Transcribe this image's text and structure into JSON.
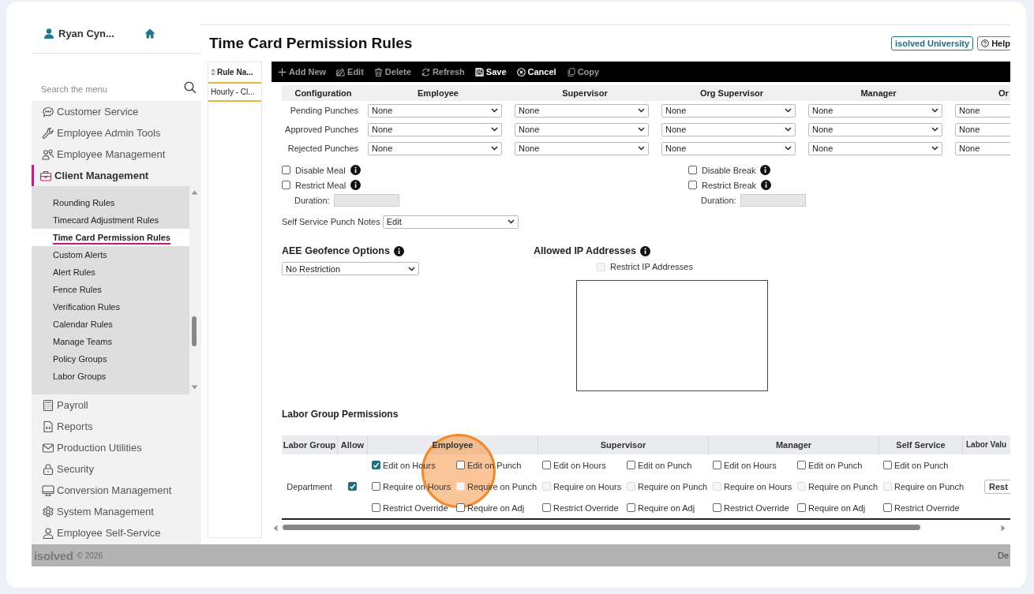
{
  "user": {
    "name": "Ryan Cyn..."
  },
  "search": {
    "placeholder": "Search the menu"
  },
  "nav": [
    {
      "label": "Customer Service",
      "selected": false
    },
    {
      "label": "Employee Admin Tools",
      "selected": false
    },
    {
      "label": "Employee Management",
      "selected": false
    },
    {
      "label": "Client Management",
      "selected": true,
      "children": [
        {
          "label": "Rounding Rules",
          "selected": false
        },
        {
          "label": "Timecard Adjustment Rules",
          "selected": false
        },
        {
          "label": "Time Card Permission Rules",
          "selected": true
        },
        {
          "label": "Custom Alerts",
          "selected": false
        },
        {
          "label": "Alert Rules",
          "selected": false
        },
        {
          "label": "Fence Rules",
          "selected": false
        },
        {
          "label": "Verification Rules",
          "selected": false
        },
        {
          "label": "Calendar Rules",
          "selected": false
        },
        {
          "label": "Manage Teams",
          "selected": false
        },
        {
          "label": "Policy Groups",
          "selected": false
        },
        {
          "label": "Labor Groups",
          "selected": false
        }
      ]
    },
    {
      "label": "Payroll",
      "selected": false
    },
    {
      "label": "Reports",
      "selected": false
    },
    {
      "label": "Production Utilities",
      "selected": false
    },
    {
      "label": "Security",
      "selected": false
    },
    {
      "label": "Conversion Management",
      "selected": false
    },
    {
      "label": "System Management",
      "selected": false
    },
    {
      "label": "Employee Self-Service",
      "selected": false
    }
  ],
  "page_title": "Time Card Permission Rules",
  "header_links": [
    {
      "label": "isolved University"
    },
    {
      "label": "Help"
    }
  ],
  "rules_list": {
    "column": "Rule Na...",
    "rows": [
      {
        "label": "Hourly - Cl...",
        "selected": true
      }
    ]
  },
  "toolbar": [
    {
      "label": "Add New",
      "disabled": true
    },
    {
      "label": "Edit",
      "disabled": true
    },
    {
      "label": "Delete",
      "disabled": true
    },
    {
      "label": "Refresh",
      "disabled": true
    },
    {
      "label": "Save",
      "disabled": false
    },
    {
      "label": "Cancel",
      "disabled": false
    },
    {
      "label": "Copy",
      "disabled": true
    }
  ],
  "configuration": {
    "columns": [
      "Configuration",
      "Employee",
      "Supervisor",
      "Org Supervisor",
      "Manager",
      "Or"
    ],
    "rows": [
      {
        "label": "Pending Punches",
        "values": [
          "None",
          "None",
          "None",
          "None",
          "None"
        ]
      },
      {
        "label": "Approved Punches",
        "values": [
          "None",
          "None",
          "None",
          "None",
          "None"
        ]
      },
      {
        "label": "Rejected Punches",
        "values": [
          "None",
          "None",
          "None",
          "None",
          "None"
        ]
      }
    ]
  },
  "meal": {
    "options": [
      {
        "label": "Disable Meal",
        "checked": false
      },
      {
        "label": "Restrict Meal",
        "checked": false
      }
    ],
    "duration_label": "Duration:"
  },
  "break": {
    "options": [
      {
        "label": "Disable Break",
        "checked": false
      },
      {
        "label": "Restrict Break",
        "checked": false
      }
    ],
    "duration_label": "Duration:"
  },
  "punch_notes": {
    "label": "Self Service Punch Notes",
    "value": "Edit"
  },
  "geofence": {
    "title": "AEE Geofence Options",
    "value": "No Restriction"
  },
  "allowed_ip": {
    "title": "Allowed IP Addresses",
    "option": {
      "label": "Restrict IP Addresses",
      "checked": false,
      "disabled": true
    }
  },
  "labor_permissions": {
    "title": "Labor Group Permissions",
    "columns": [
      "Labor Group",
      "Allow",
      "Employee",
      "Supervisor",
      "Manager",
      "Self Service",
      "Labor Valu"
    ],
    "rows": [
      {
        "group": "Department",
        "allow": true,
        "labor_value_button": "Rest",
        "permissions": [
          {
            "options": [
              [
                {
                  "label": "Edit on Hours",
                  "checked": true,
                  "disabled": false
                },
                {
                  "label": "Edit on Punch",
                  "checked": false,
                  "disabled": false
                }
              ],
              [
                {
                  "label": "Require on Hours",
                  "checked": false,
                  "disabled": false
                },
                {
                  "label": "Require on Punch",
                  "checked": false,
                  "disabled": true
                }
              ],
              [
                {
                  "label": "Restrict Override",
                  "checked": false,
                  "disabled": false
                },
                {
                  "label": "Require on Adj",
                  "checked": false,
                  "disabled": false
                }
              ]
            ]
          },
          {
            "options": [
              [
                {
                  "label": "Edit on Hours",
                  "checked": false,
                  "disabled": false
                },
                {
                  "label": "Edit on Punch",
                  "checked": false,
                  "disabled": false
                }
              ],
              [
                {
                  "label": "Require on Hours",
                  "checked": false,
                  "disabled": true
                },
                {
                  "label": "Require on Punch",
                  "checked": false,
                  "disabled": true
                }
              ],
              [
                {
                  "label": "Restrict Override",
                  "checked": false,
                  "disabled": false
                },
                {
                  "label": "Require on Adj",
                  "checked": false,
                  "disabled": false
                }
              ]
            ]
          },
          {
            "options": [
              [
                {
                  "label": "Edit on Hours",
                  "checked": false,
                  "disabled": false
                },
                {
                  "label": "Edit on Punch",
                  "checked": false,
                  "disabled": false
                }
              ],
              [
                {
                  "label": "Require on Hours",
                  "checked": false,
                  "disabled": true
                },
                {
                  "label": "Require on Punch",
                  "checked": false,
                  "disabled": true
                }
              ],
              [
                {
                  "label": "Restrict Override",
                  "checked": false,
                  "disabled": false
                },
                {
                  "label": "Require on Adj",
                  "checked": false,
                  "disabled": false
                }
              ]
            ]
          },
          {
            "options": [
              [
                {
                  "label": "Edit on Punch",
                  "checked": false,
                  "disabled": false
                }
              ],
              [
                {
                  "label": "Require on Punch",
                  "checked": false,
                  "disabled": true
                }
              ],
              [
                {
                  "label": "Restrict Override",
                  "checked": false,
                  "disabled": false
                }
              ]
            ]
          }
        ]
      }
    ]
  },
  "footer": {
    "logo": "isolved",
    "copyright": "© 2026",
    "right_text": "De"
  }
}
